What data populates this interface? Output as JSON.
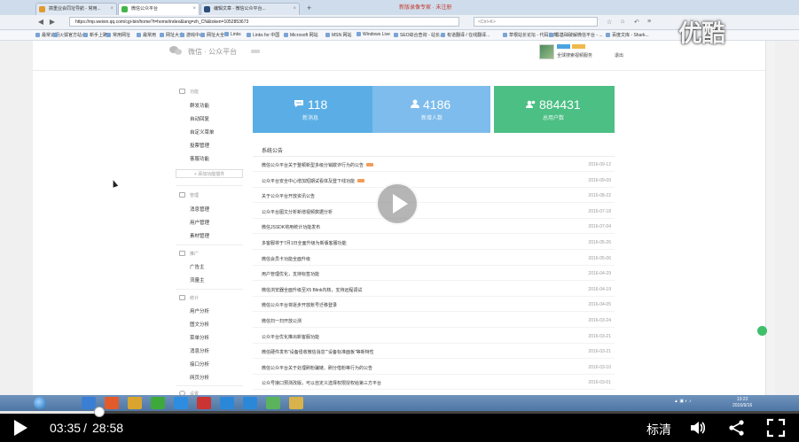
{
  "browser": {
    "tabs": [
      {
        "label": "搞重业会同址导航 - 常用...",
        "color": "#e39a2d"
      },
      {
        "label": "微信公众平台",
        "color": "#44b549"
      },
      {
        "label": "编辑文章 - 微信公众平台...",
        "color": "#2a4d7a"
      }
    ],
    "window_title": "新版录像专家 · 未注册",
    "url": "https://mp.weixin.qq.com/cgi-bin/home?t=home/index&lang=zh_CN&token=1052853673",
    "search_placeholder": "<Ctrl+K>"
  },
  "bookmarks": [
    "最常访问",
    "火狐官方站点",
    "新手上路",
    "常用网址",
    "最常用",
    "网址大全",
    "游戏中心",
    "网址大全",
    "Links",
    "Links for 中国",
    "Microsoft 网站",
    "MSN 网站",
    "Windows Live",
    "SEO综合查询 - 站长...",
    "有道翻译 / 在线翻译...",
    "草根站长论坛 - 代码志向...",
    "零基础破解微信平台 - ...",
    "百度文库 - Shark..."
  ],
  "header": {
    "logo_text": "微信 · 公众平台",
    "account_name": "全球搜索视频服务",
    "logout": "退出"
  },
  "sidebar": {
    "sections": [
      {
        "title": "功能",
        "items": [
          "群发功能",
          "自动回复",
          "自定义菜单",
          "投票管理",
          "客服功能"
        ]
      },
      {
        "title": "管理",
        "items": [
          "消息管理",
          "用户管理",
          "素材管理"
        ]
      },
      {
        "title": "推广",
        "items": [
          "广告主",
          "流量主"
        ]
      },
      {
        "title": "统计",
        "items": [
          "用户分析",
          "图文分析",
          "菜单分析",
          "消息分析",
          "接口分析",
          "网页分析"
        ]
      },
      {
        "title": "设置",
        "items": []
      }
    ],
    "add_plugin": "+ 添加功能插件"
  },
  "stats": [
    {
      "value": "118",
      "label": "新消息",
      "color": "#5aaee5"
    },
    {
      "value": "4186",
      "label": "新增人数",
      "color": "#7dbcec"
    },
    {
      "value": "884431",
      "label": "总用户数",
      "color": "#4cbf84"
    }
  ],
  "notices": {
    "title": "系统公告",
    "items": [
      {
        "text": "微信公众平台关于整顿新型多级分销欺诈行为的公告",
        "date": "2016-09-12",
        "new": true
      },
      {
        "text": "公众平台安全中心增加短期试看体及登下线功能",
        "date": "2016-09-09",
        "new": true
      },
      {
        "text": "关于公众平台开放资讯公告",
        "date": "2016-08-22",
        "new": false
      },
      {
        "text": "公众平台图文分析新增视频数据分析",
        "date": "2016-07-18",
        "new": false
      },
      {
        "text": "微信JSSDK将用统计功能发布",
        "date": "2016-07-04",
        "new": false
      },
      {
        "text": "多客服将于7月1日全面升级为新版客服功能",
        "date": "2016-05-26",
        "new": false
      },
      {
        "text": "微信会员卡功能全面升级",
        "date": "2016-05-06",
        "new": false
      },
      {
        "text": "用户管理优化，支持标签功能",
        "date": "2016-04-29",
        "new": false
      },
      {
        "text": "微信浏览器全面升级至X5 Blink内核，支持远程调试",
        "date": "2016-04-19",
        "new": false
      },
      {
        "text": "微信公众平台将逐步开放账号迁移登录",
        "date": "2016-04-05",
        "new": false
      },
      {
        "text": "微信扫一扫开放公测",
        "date": "2016-03-24",
        "new": false
      },
      {
        "text": "公众平台优化推出新客服功能",
        "date": "2016-03-21",
        "new": false
      },
      {
        "text": "微信硬件发布“设备侵收微信消息”“设备标准面板”等新特性",
        "date": "2016-03-21",
        "new": false
      },
      {
        "text": "微信公众平台关于处理刷粉骗链、刷分借粉等行为的公告",
        "date": "2016-03-10",
        "new": false
      },
      {
        "text": "公众号接口预测改版，可以自定义选择权限授权给第三方平台",
        "date": "2016-03-01",
        "new": false
      }
    ]
  },
  "watermark": "优酷",
  "taskbar": {
    "apps": [
      "#3b7fd4",
      "#e35b2a",
      "#d9a52f",
      "#3ea93b",
      "#2d8de0",
      "#c33",
      "#2b88d8",
      "#2b88d8",
      "#5bb35b",
      "#d8b24a"
    ],
    "clock_time": "13:22",
    "clock_date": "2016/9/16"
  },
  "player": {
    "current_time": "03:35",
    "separator": "/",
    "total_time": "28:58",
    "progress": 0.124,
    "quality": "标清"
  }
}
